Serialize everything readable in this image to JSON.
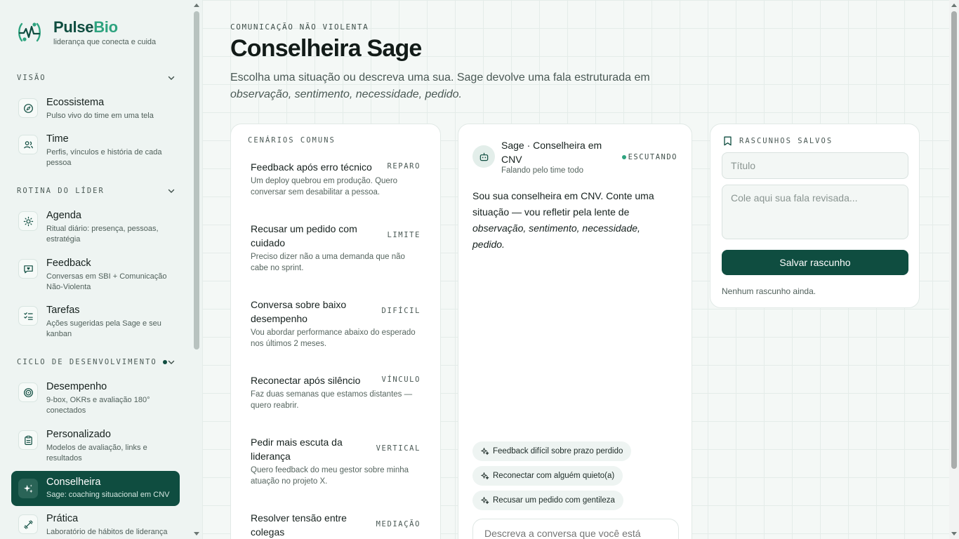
{
  "brand": {
    "name_main": "Pulse",
    "name_accent": "Bio",
    "tagline": "liderança que conecta e cuida"
  },
  "sidebar": {
    "sections": [
      {
        "label": "VISÃO",
        "items": [
          {
            "icon": "compass-icon",
            "title": "Ecossistema",
            "subtitle": "Pulso vivo do time em uma tela"
          },
          {
            "icon": "users-icon",
            "title": "Time",
            "subtitle": "Perfis, vínculos e história de cada pessoa"
          }
        ]
      },
      {
        "label": "ROTINA DO LÍDER",
        "items": [
          {
            "icon": "sun-icon",
            "title": "Agenda",
            "subtitle": "Ritual diário: presença, pessoas, estratégia"
          },
          {
            "icon": "message-heart-icon",
            "title": "Feedback",
            "subtitle": "Conversas em SBI + Comunicação Não-Violenta"
          },
          {
            "icon": "checklist-icon",
            "title": "Tarefas",
            "subtitle": "Ações sugeridas pela Sage e seu kanban"
          }
        ]
      },
      {
        "label": "CICLO DE DESENVOLVIMENTO",
        "has_dot": true,
        "items": [
          {
            "icon": "target-icon",
            "title": "Desempenho",
            "subtitle": "9-box, OKRs e avaliação 180° conectados"
          },
          {
            "icon": "clipboard-icon",
            "title": "Personalizado",
            "subtitle": "Modelos de avaliação, links e resultados"
          },
          {
            "icon": "sparkles-icon",
            "title": "Conselheira",
            "subtitle": "Sage: coaching situacional em CNV",
            "active": true
          },
          {
            "icon": "dumbbell-icon",
            "title": "Prática",
            "subtitle": "Laboratório de hábitos de liderança"
          }
        ]
      }
    ]
  },
  "header": {
    "eyebrow": "COMUNICAÇÃO NÃO VIOLENTA",
    "title": "Conselheira Sage",
    "description_lead": "Escolha uma situação ou descreva uma sua. Sage devolve uma fala estruturada em",
    "description_em": "observação, sentimento, necessidade, pedido."
  },
  "scenarios": {
    "heading": "CENÁRIOS COMUNS",
    "items": [
      {
        "title": "Feedback após erro técnico",
        "tag": "REPARO",
        "desc": "Um deploy quebrou em produção. Quero conversar sem desabilitar a pessoa."
      },
      {
        "title": "Recusar um pedido com cuidado",
        "tag": "LIMITE",
        "desc": "Preciso dizer não a uma demanda que não cabe no sprint."
      },
      {
        "title": "Conversa sobre baixo desempenho",
        "tag": "DIFÍCIL",
        "desc": "Vou abordar performance abaixo do esperado nos últimos 2 meses."
      },
      {
        "title": "Reconectar após silêncio",
        "tag": "VÍNCULO",
        "desc": "Faz duas semanas que estamos distantes — quero reabrir."
      },
      {
        "title": "Pedir mais escuta da liderança",
        "tag": "VERTICAL",
        "desc": "Quero feedback do meu gestor sobre minha atuação no projeto X."
      },
      {
        "title": "Resolver tensão entre colegas",
        "tag": "MEDIAÇÃO",
        "desc": ""
      }
    ]
  },
  "chat": {
    "name": "Sage · Conselheira em CNV",
    "subtitle": "Falando pelo time todo",
    "status": "ESCUTANDO",
    "message_lead": "Sou sua conselheira em CNV. Conte uma situação — vou refletir pela lente de",
    "message_em": "observação, sentimento, necessidade, pedido.",
    "suggestions": [
      "Feedback difícil sobre prazo perdido",
      "Reconectar com alguém quieto(a)",
      "Recusar um pedido com gentileza"
    ],
    "input_placeholder": "Descreva a conversa que você está"
  },
  "drafts": {
    "heading": "RASCUNHOS SALVOS",
    "title_placeholder": "Título",
    "body_placeholder": "Cole aqui sua fala revisada...",
    "save_label": "Salvar rascunho",
    "empty_text": "Nenhum rascunho ainda."
  },
  "colors": {
    "brand": "#0f4d40",
    "accent": "#2ea37f",
    "status_dot": "#2ea37f"
  }
}
